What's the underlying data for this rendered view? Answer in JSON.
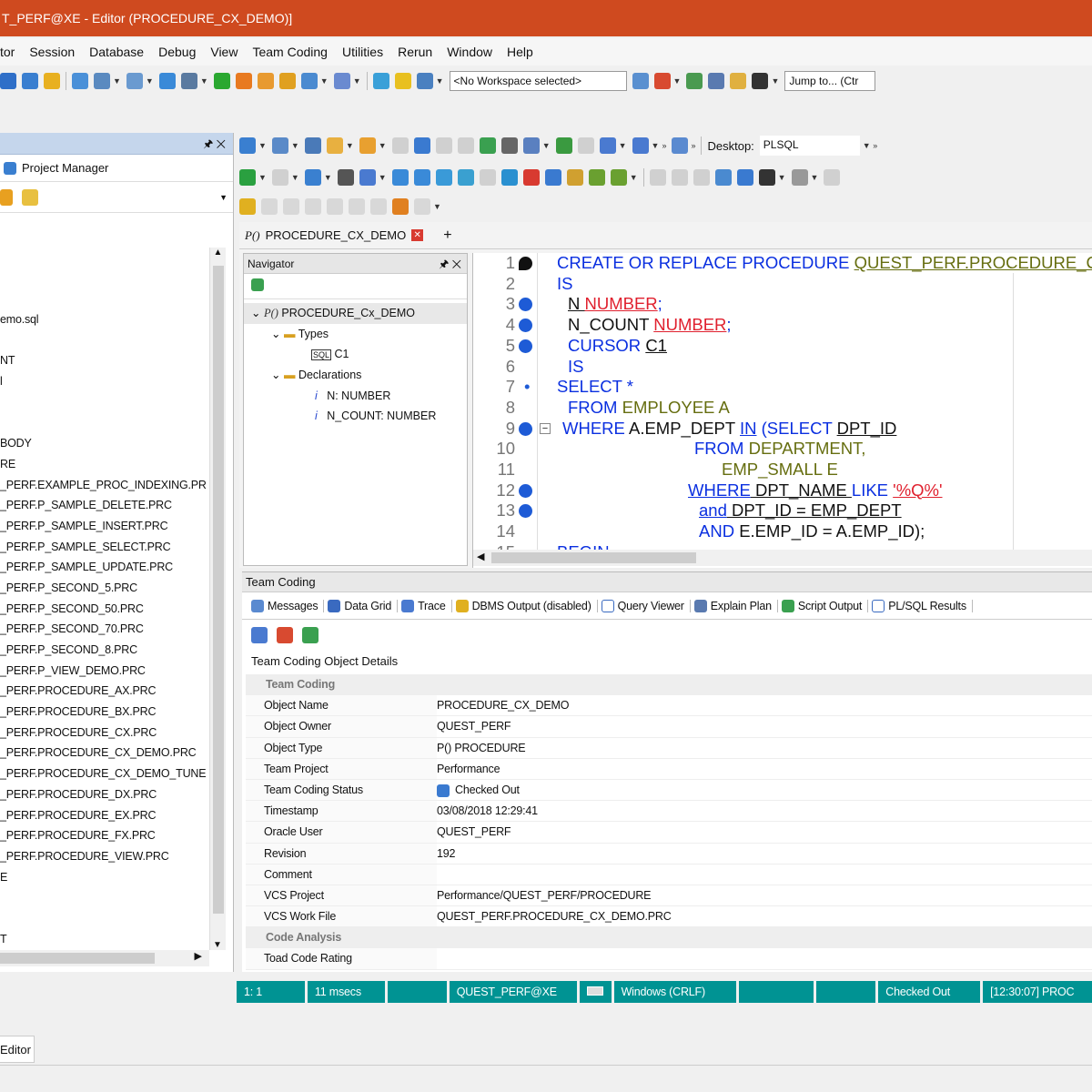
{
  "window": {
    "title": "T_PERF@XE - Editor (PROCEDURE_CX_DEMO)]"
  },
  "menu": [
    "tor",
    "Session",
    "Database",
    "Debug",
    "View",
    "Team Coding",
    "Utilities",
    "Rerun",
    "Window",
    "Help"
  ],
  "toolbar": {
    "workspace": "<No Workspace selected>",
    "jump": "Jump to... (Ctr"
  },
  "left": {
    "title": "Project Manager",
    "items": [
      "emo.sql",
      "NT",
      "l",
      "BODY",
      "RE",
      "_PERF.EXAMPLE_PROC_INDEXING.PR",
      "_PERF.P_SAMPLE_DELETE.PRC",
      "_PERF.P_SAMPLE_INSERT.PRC",
      "_PERF.P_SAMPLE_SELECT.PRC",
      "_PERF.P_SAMPLE_UPDATE.PRC",
      "_PERF.P_SECOND_5.PRC",
      "_PERF.P_SECOND_50.PRC",
      "_PERF.P_SECOND_70.PRC",
      "_PERF.P_SECOND_8.PRC",
      "_PERF.P_VIEW_DEMO.PRC",
      "_PERF.PROCEDURE_AX.PRC",
      "_PERF.PROCEDURE_BX.PRC",
      "_PERF.PROCEDURE_CX.PRC",
      "_PERF.PROCEDURE_CX_DEMO.PRC",
      "_PERF.PROCEDURE_CX_DEMO_TUNE",
      "_PERF.PROCEDURE_DX.PRC",
      "_PERF.PROCEDURE_EX.PRC",
      "_PERF.PROCEDURE_FX.PRC",
      "_PERF.PROCEDURE_VIEW.PRC",
      "E",
      "T"
    ]
  },
  "desktop": {
    "label": "Desktop:",
    "value": "PLSQL"
  },
  "editor_tab": {
    "prefix": "P()",
    "label": "PROCEDURE_CX_DEMO"
  },
  "navigator": {
    "title": "Navigator",
    "root": "PROCEDURE_Cx_DEMO",
    "types": "Types",
    "c1": "C1",
    "declarations": "Declarations",
    "n": "N: NUMBER",
    "ncount": "N_COUNT: NUMBER"
  },
  "code": {
    "l1a": "CREATE OR REPLACE PROCEDURE ",
    "l1b": "QUEST_PERF.PROCEDURE_C",
    "l2": "IS",
    "l3a": "N ",
    "l3b": "NUMBER",
    "l3c": ";",
    "l4a": "N_COUNT ",
    "l4b": "NUMBER",
    "l4c": ";",
    "l5a": "CURSOR ",
    "l5b": "C1",
    "l6": "IS",
    "l7": "SELECT *",
    "l8a": "FROM ",
    "l8b": "EMPLOYEE A",
    "l9a": "WHERE ",
    "l9b": "A.EMP_DEPT ",
    "l9c": "IN",
    " l9d": " (SELECT ",
    "l9e": "DPT_ID",
    "l10a": "FROM ",
    "l10b": "DEPARTMENT,",
    "l11": "EMP_SMALL E",
    "l12a": "WHERE",
    " l12b": " DPT_NAME ",
    "l12c": "LIKE ",
    "l12d": "'%Q%'",
    "l13a": "and",
    " l13b": " DPT_ID = EMP_DEPT",
    "l14a": "AND ",
    "l14b": "E.EMP_ID = A.EMP_ID);",
    "l15": "BEGIN"
  },
  "team_coding": {
    "title": "Team Coding",
    "tabs": [
      "Messages",
      "Data Grid",
      "Trace",
      "DBMS Output (disabled)",
      "Query Viewer",
      "Explain Plan",
      "Script Output",
      "PL/SQL Results"
    ],
    "details_title": "Team Coding Object Details",
    "cat1": "Team Coding",
    "rows": [
      {
        "k": "Object Name",
        "v": "PROCEDURE_CX_DEMO"
      },
      {
        "k": "Object Owner",
        "v": "QUEST_PERF"
      },
      {
        "k": "Object Type",
        "v": "P() PROCEDURE"
      },
      {
        "k": "Team Project",
        "v": "Performance"
      },
      {
        "k": "Team Coding Status",
        "v": "Checked Out"
      },
      {
        "k": "Timestamp",
        "v": "03/08/2018 12:29:41"
      },
      {
        "k": "Oracle User",
        "v": "QUEST_PERF"
      },
      {
        "k": "Revision",
        "v": "192"
      },
      {
        "k": "Comment",
        "v": ""
      },
      {
        "k": "VCS Project",
        "v": "Performance/QUEST_PERF/PROCEDURE"
      },
      {
        "k": "VCS Work File",
        "v": "QUEST_PERF.PROCEDURE_CX_DEMO.PRC"
      }
    ],
    "cat2": "Code Analysis",
    "last": {
      "k": "Toad Code Rating",
      "v": ""
    }
  },
  "status": {
    "pos": "1:   1",
    "time": "11 msecs",
    "conn": "QUEST_PERF@XE",
    "crlf": "Windows (CRLF)",
    "co": "Checked Out",
    "clock": "[12:30:07]  PROC"
  },
  "bottom": {
    "tab": "Editor"
  }
}
